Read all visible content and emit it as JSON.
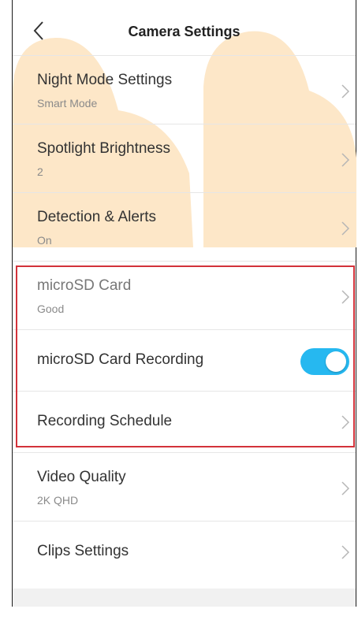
{
  "header": {
    "title": "Camera Settings",
    "back_icon": "chevron-left-icon"
  },
  "colors": {
    "accent": "#26b8f0",
    "highlight_border": "#d3323a",
    "decor_shape": "#fde7c8"
  },
  "settings": {
    "night_mode": {
      "title": "Night Mode Settings",
      "value": "Smart Mode"
    },
    "spotlight": {
      "title": "Spotlight Brightness",
      "value": "2"
    },
    "detection": {
      "title": "Detection & Alerts",
      "value": "On"
    },
    "microsd": {
      "title": "microSD Card",
      "value": "Good"
    },
    "microsd_recording": {
      "title": "microSD Card Recording",
      "enabled": true
    },
    "recording_schedule": {
      "title": "Recording Schedule"
    },
    "video_quality": {
      "title": "Video Quality",
      "value": "2K QHD"
    },
    "clips": {
      "title": "Clips Settings"
    }
  }
}
